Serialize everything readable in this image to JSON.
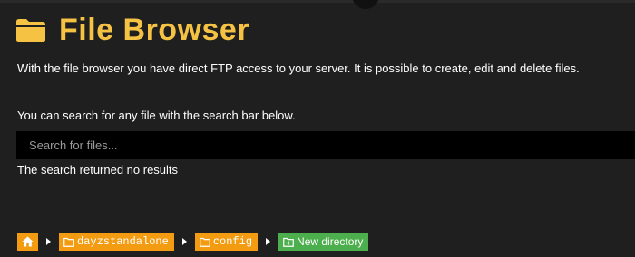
{
  "header": {
    "title": "File Browser",
    "title_color": "#f6c244",
    "icon": "folder-icon"
  },
  "content": {
    "intro": "With the file browser you have direct FTP access to your server. It is possible to create, edit and delete files.",
    "search_hint": "You can search for any file with the search bar below.",
    "search_placeholder": "Search for files...",
    "search_value": "",
    "search_result": "The search returned no results"
  },
  "breadcrumb": {
    "home_icon": "home-icon",
    "items": [
      {
        "label": "dayzstandalone",
        "icon": "folder-icon"
      },
      {
        "label": "config",
        "icon": "folder-icon"
      }
    ],
    "new_directory_label": "New directory",
    "new_directory_icon": "new-folder-icon",
    "colors": {
      "folder": "#f39c12",
      "new_directory": "#4cae4c"
    }
  }
}
